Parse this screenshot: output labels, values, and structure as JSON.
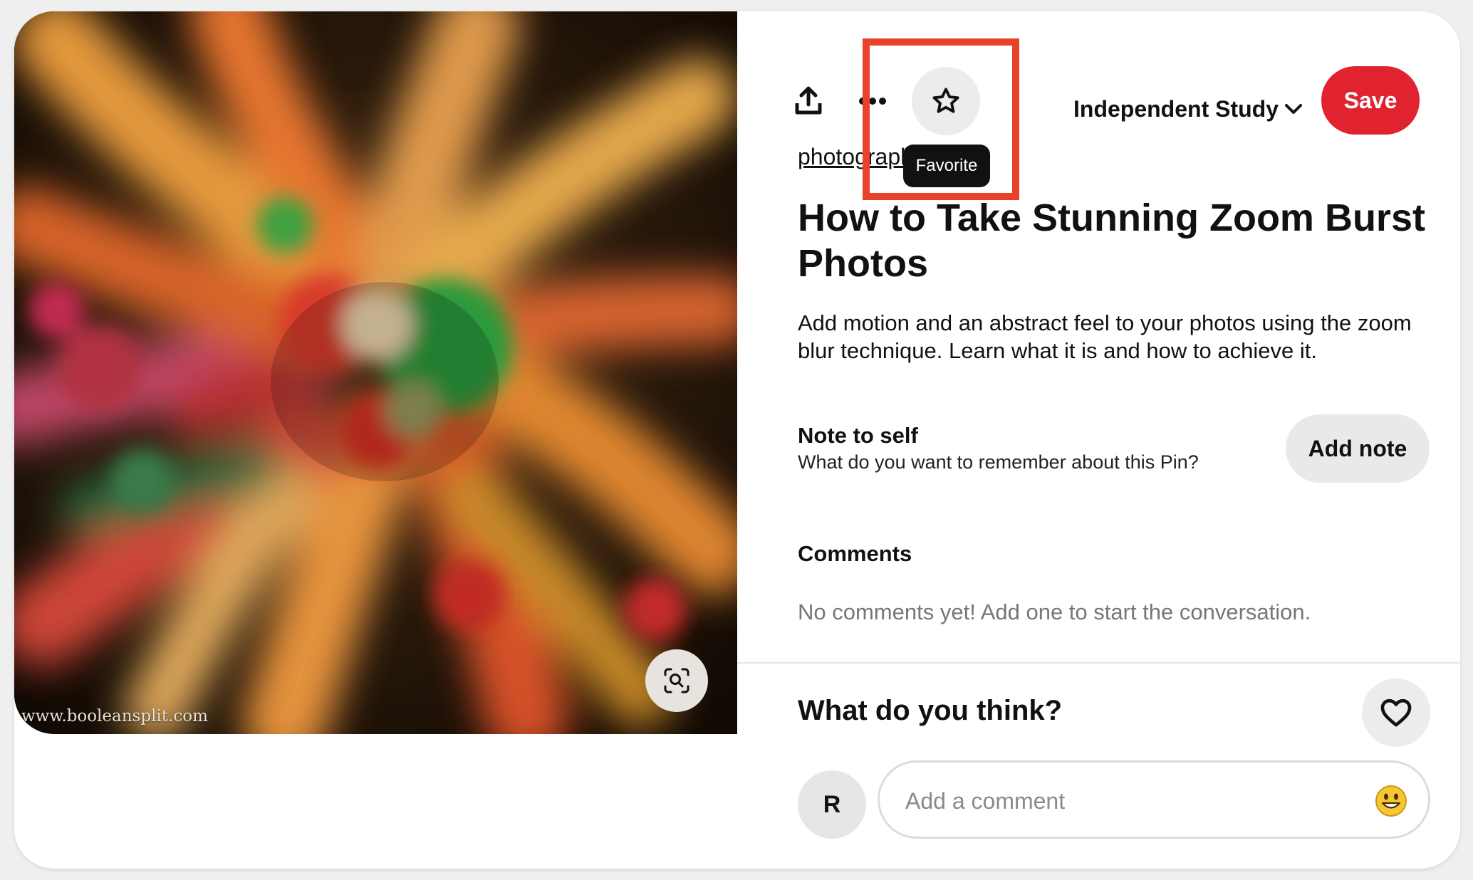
{
  "image": {
    "watermark": "www.booleansplit.com"
  },
  "toolbar": {
    "tooltip": "Favorite",
    "board": "Independent Study",
    "save_label": "Save",
    "icons": [
      "share-icon",
      "more-icon",
      "star-icon",
      "chevron-down-icon",
      "visual-search-icon"
    ]
  },
  "pin": {
    "source_link": "photography.com",
    "title": "How to Take Stunning Zoom Burst Photos",
    "description": "Add motion and an abstract feel to your photos using the zoom blur technique. Learn what it is and how to achieve it."
  },
  "note": {
    "heading": "Note to self",
    "subtext": "What do you want to remember about this Pin?",
    "button_label": "Add note"
  },
  "comments": {
    "heading": "Comments",
    "empty_text": "No comments yet! Add one to start the conversation."
  },
  "footer": {
    "prompt": "What do you think?",
    "avatar_initial": "R",
    "comment_placeholder": "Add a comment",
    "icons": [
      "heart-icon",
      "emoji-icon"
    ]
  },
  "colors": {
    "save_button": "#e0232f",
    "highlight_box": "#e8422b",
    "tooltip_bg": "#111111"
  }
}
